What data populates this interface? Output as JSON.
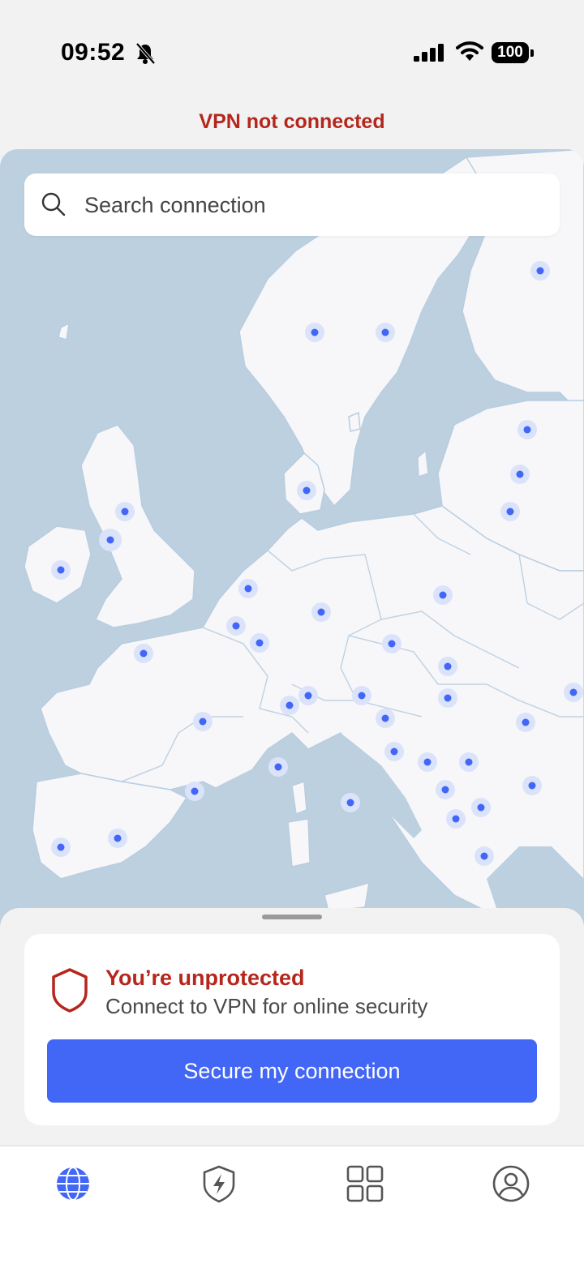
{
  "status_bar": {
    "time": "09:52",
    "battery": "100"
  },
  "vpn_status": "VPN not connected",
  "search": {
    "placeholder": "Search connection"
  },
  "protection_card": {
    "title": "You’re unprotected",
    "subtitle": "Connect to VPN for online security",
    "button_label": "Secure my connection"
  },
  "colors": {
    "warning": "#b5261c",
    "accent": "#4266f5",
    "map_sea": "#bcd0df",
    "map_land": "#f7f7f9"
  },
  "tabs": [
    {
      "icon": "globe-icon",
      "active": true
    },
    {
      "icon": "shield-bolt-icon",
      "active": false
    },
    {
      "icon": "grid-icon",
      "active": false
    },
    {
      "icon": "profile-icon",
      "active": false
    }
  ]
}
